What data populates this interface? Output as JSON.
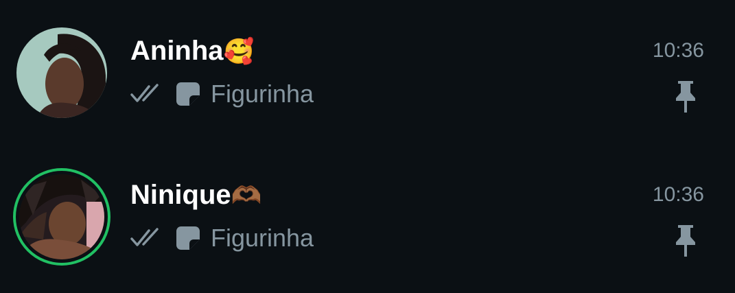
{
  "chats": [
    {
      "name": "Aninha",
      "name_emoji": "🥰",
      "time": "10:36",
      "preview_text": "Figurinha",
      "read_status": "double-check-icon",
      "preview_icon": "sticker-icon",
      "pinned": true,
      "has_status_ring": false
    },
    {
      "name": "Ninique",
      "name_emoji": "🫶🏾",
      "time": "10:36",
      "preview_text": "Figurinha",
      "read_status": "double-check-icon",
      "preview_icon": "sticker-icon",
      "pinned": true,
      "has_status_ring": true
    }
  ],
  "colors": {
    "background": "#0b1014",
    "name_text": "#ffffff",
    "secondary_text": "#8696a0",
    "status_ring": "#21c063"
  }
}
